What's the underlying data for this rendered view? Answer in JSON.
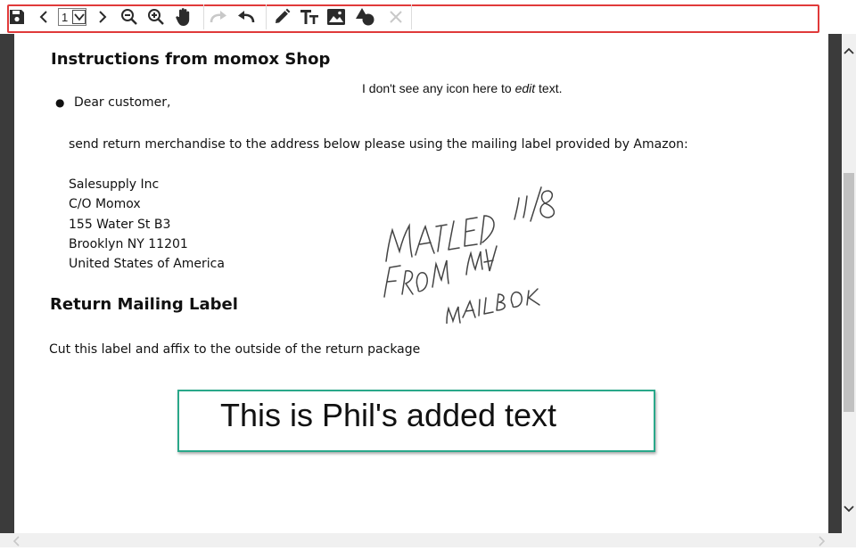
{
  "toolbar": {
    "page_value": "1",
    "tools": [
      {
        "name": "save-icon"
      },
      {
        "name": "previous-page-icon"
      },
      {
        "name": "next-page-icon"
      },
      {
        "name": "zoom-out-icon"
      },
      {
        "name": "zoom-in-icon"
      },
      {
        "name": "hand-pan-icon"
      },
      {
        "name": "redo-icon",
        "disabled": true
      },
      {
        "name": "undo-icon"
      },
      {
        "name": "pencil-icon"
      },
      {
        "name": "text-tool-icon"
      },
      {
        "name": "image-icon"
      },
      {
        "name": "shapes-icon"
      },
      {
        "name": "close-icon",
        "disabled": true
      }
    ],
    "highlight_color": "#e03a3a"
  },
  "document": {
    "heading1": "Instructions from momox Shop",
    "note": "I don't see any icon here to",
    "note_em": "edit",
    "note_tail": "text.",
    "bullet": "Dear customer,",
    "instruction": "send return merchandise to the address below please using the mailing label provided by Amazon:",
    "address": [
      "Salesupply Inc",
      "C/O Momox",
      "155 Water St B3",
      "Brooklyn NY 11201",
      "United States of America"
    ],
    "heading2": "Return Mailing Label",
    "cut_text": "Cut this label and affix to the outside of the return package",
    "handwriting": [
      "MAILED",
      "11/8",
      "FROM MY",
      "MAILBOX"
    ],
    "added_text": "This is Phil's added text",
    "added_box_color": "#2aa88a"
  }
}
